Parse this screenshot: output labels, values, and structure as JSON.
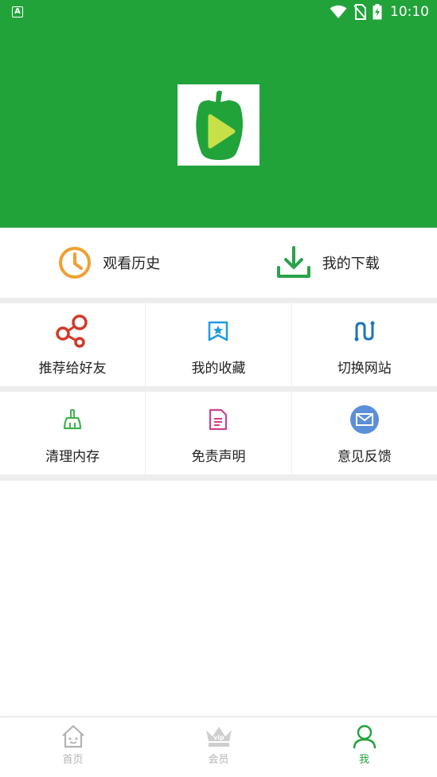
{
  "status_bar": {
    "indicator": "A",
    "time": "10:10"
  },
  "colors": {
    "brand_green": "#21a33a",
    "history_orange": "#f0a030",
    "download_green": "#2aa34a",
    "share_red": "#d03a2a",
    "favorite_blue": "#1e9be0",
    "switch_blue": "#1e73be",
    "clean_green": "#3fb34f",
    "disclaimer_pink": "#d0408a",
    "feedback_blue": "#5b8fd8",
    "tab_inactive": "#b3b3b3"
  },
  "quick_actions": [
    {
      "label": "观看历史",
      "icon": "clock-icon"
    },
    {
      "label": "我的下载",
      "icon": "download-icon"
    }
  ],
  "grid": [
    [
      {
        "label": "推荐给好友",
        "icon": "share-icon"
      },
      {
        "label": "我的收藏",
        "icon": "bookmark-star-icon"
      },
      {
        "label": "切换网站",
        "icon": "switch-icon"
      }
    ],
    [
      {
        "label": "清理内存",
        "icon": "broom-icon"
      },
      {
        "label": "免责声明",
        "icon": "document-icon"
      },
      {
        "label": "意见反馈",
        "icon": "mail-icon"
      }
    ]
  ],
  "tabs": [
    {
      "label": "首页",
      "icon": "home-icon",
      "active": false
    },
    {
      "label": "会员",
      "icon": "vip-crown-icon",
      "vip_text": "vip",
      "active": false
    },
    {
      "label": "我",
      "icon": "person-icon",
      "active": true
    }
  ]
}
